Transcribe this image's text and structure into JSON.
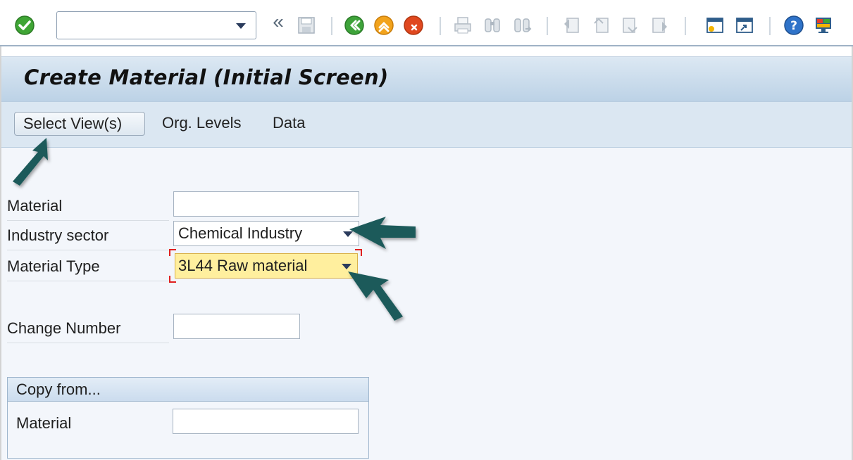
{
  "toolbar": {
    "command_value": "",
    "icons": [
      "checkmark-icon",
      "collapse-icon",
      "save-icon",
      "back-icon",
      "exit-icon",
      "cancel-icon",
      "print-icon",
      "find-icon",
      "find-next-icon",
      "first-page-icon",
      "previous-page-icon",
      "next-page-icon",
      "last-page-icon",
      "create-session-icon",
      "shortcut-icon",
      "help-icon",
      "customize-layout-icon"
    ]
  },
  "title": "Create Material (Initial Screen)",
  "app_toolbar": {
    "select_views": "Select View(s)",
    "org_levels": "Org. Levels",
    "data": "Data"
  },
  "form": {
    "material_label": "Material",
    "material_value": "",
    "industry_label": "Industry sector",
    "industry_value": "Chemical Industry",
    "type_label": "Material Type",
    "type_value": "3L44 Raw material",
    "change_label": "Change Number",
    "change_value": ""
  },
  "copy_from": {
    "title": "Copy from...",
    "material_label": "Material",
    "material_value": ""
  },
  "colors": {
    "accent": "#1f5f5f",
    "highlight": "#ffef9e",
    "title_bg": "#c9dbec"
  }
}
